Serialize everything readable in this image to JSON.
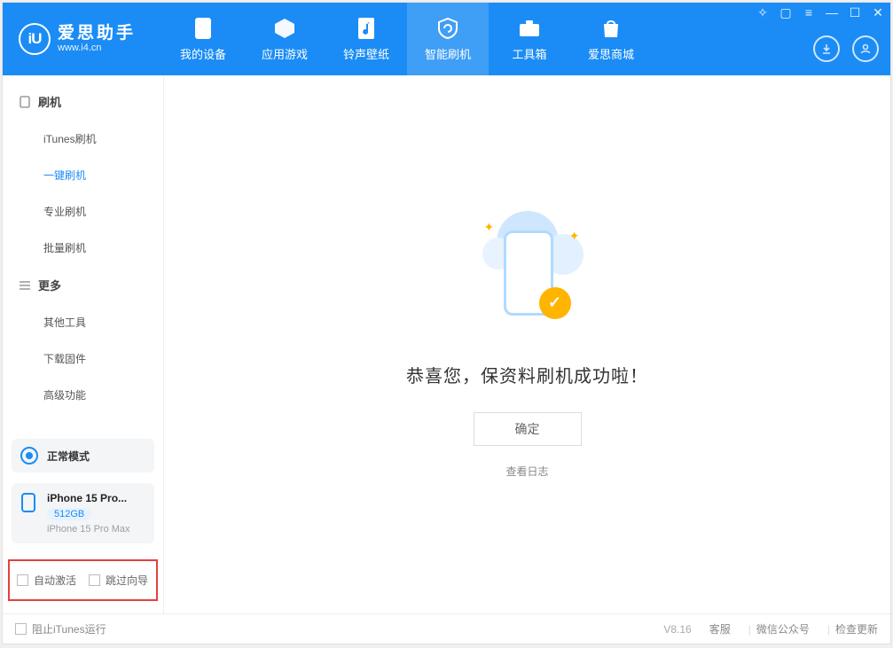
{
  "app": {
    "title": "爱思助手",
    "subtitle": "www.i4.cn",
    "logo_text": "iU"
  },
  "top_nav": [
    {
      "label": "我的设备"
    },
    {
      "label": "应用游戏"
    },
    {
      "label": "铃声壁纸"
    },
    {
      "label": "智能刷机"
    },
    {
      "label": "工具箱"
    },
    {
      "label": "爱思商城"
    }
  ],
  "sidebar": {
    "group1_label": "刷机",
    "items1": [
      {
        "label": "iTunes刷机"
      },
      {
        "label": "一键刷机"
      },
      {
        "label": "专业刷机"
      },
      {
        "label": "批量刷机"
      }
    ],
    "group2_label": "更多",
    "items2": [
      {
        "label": "其他工具"
      },
      {
        "label": "下载固件"
      },
      {
        "label": "高级功能"
      }
    ],
    "mode_label": "正常模式",
    "device": {
      "name": "iPhone 15 Pro...",
      "storage": "512GB",
      "model": "iPhone 15 Pro Max"
    },
    "auto_activate_label": "自动激活",
    "skip_wizard_label": "跳过向导"
  },
  "main": {
    "success_title": "恭喜您，保资料刷机成功啦！",
    "ok_button": "确定",
    "view_log": "查看日志"
  },
  "footer": {
    "block_itunes_label": "阻止iTunes运行",
    "version": "V8.16",
    "support": "客服",
    "wechat": "微信公众号",
    "check_update": "检查更新"
  }
}
